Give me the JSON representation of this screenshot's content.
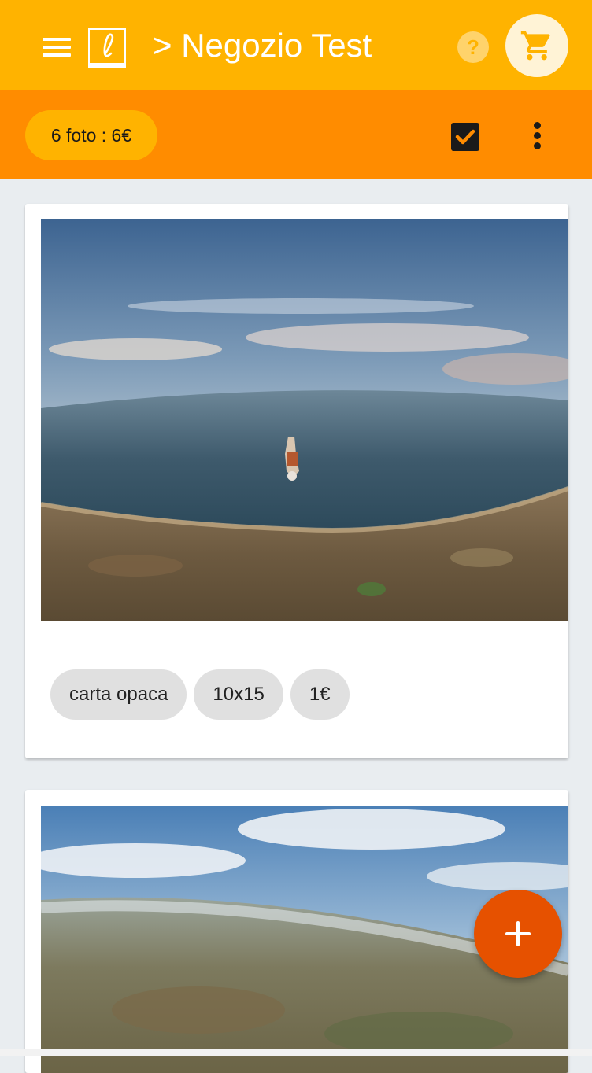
{
  "header": {
    "title": "> Negozio Test",
    "menu_icon": "menu-icon",
    "logo_icon": "script-l-logo",
    "help_icon": "help-icon",
    "cart_icon": "cart-icon",
    "colors": {
      "header_background": "#ffb300",
      "toolbar_background": "#ff8c00",
      "fab_background": "#e65100",
      "page_background": "#e9edf0"
    }
  },
  "toolbar": {
    "photo_count_label": "6 foto : 6€",
    "select_all_icon": "checkbox-checked-icon",
    "more_icon": "more-vertical-icon"
  },
  "photos": [
    {
      "chips": [
        {
          "label": "carta opaca"
        },
        {
          "label": "10x15"
        },
        {
          "label": "1€"
        }
      ]
    },
    {
      "chips": []
    }
  ],
  "fab": {
    "icon": "plus-icon"
  }
}
